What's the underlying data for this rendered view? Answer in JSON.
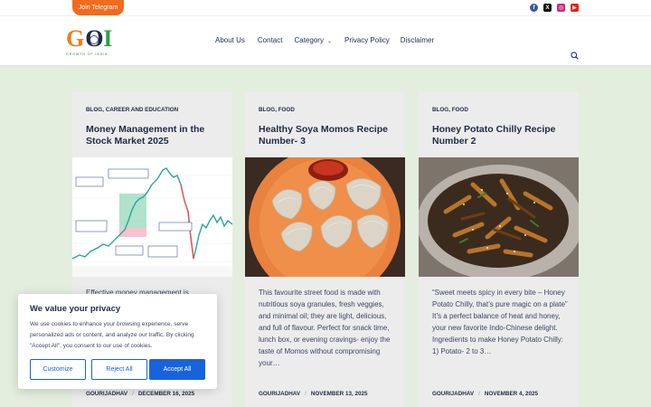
{
  "topbar": {
    "telegram_label": "Join Telegram"
  },
  "socials": [
    "facebook-icon",
    "x-icon",
    "instagram-icon",
    "youtube-icon"
  ],
  "logo": {
    "tagline": "GROWTH OF INDIA"
  },
  "nav": {
    "about": "About Us",
    "contact": "Contact",
    "category": "Category",
    "privacy": "Privacy Policy",
    "disclaimer": "Disclaimer"
  },
  "posts": [
    {
      "categories": "BLOG, CAREER AND EDUCATION",
      "title": "Money Management in the Stock Market 2025",
      "excerpt": "Effective money management is",
      "author": "GOURIJADHAV",
      "date": "DECEMBER 16, 2025"
    },
    {
      "categories": "BLOG, FOOD",
      "title": "Healthy Soya Momos Recipe Number- 3",
      "excerpt": "This favourite street food is made with nutritious soya granules, fresh veggies, and minimal oil; they are light, delicious, and full of flavour. Perfect for snack time, lunch box, or evening cravings- enjoy the taste of Momos without compromising your…",
      "author": "GOURIJADHAV",
      "date": "NOVEMBER 13, 2025"
    },
    {
      "categories": "BLOG, FOOD",
      "title": "Honey Potato Chilly Recipe Number 2",
      "excerpt": "“Sweet meets spicy in every bite – Honey Potato Chilly, that’s pure magic on a plate” It’s a perfect balance of heat and honey, your new favorite Indo-Chinese delight. Ingredients to make Honey Potato Chilly: 1) Potato- 2 to 3…",
      "author": "GOURIJADHAV",
      "date": "NOVEMBER 4, 2025"
    }
  ],
  "cookie": {
    "title": "We value your privacy",
    "text": "We use cookies to enhance your browsing experience, serve personalized ads or content, and analyze our traffic. By clicking \"Accept All\", you consent to our use of cookies.",
    "customize": "Customize",
    "reject": "Reject All",
    "accept": "Accept All"
  },
  "colors": {
    "accent": "#f06b1d",
    "primary_button": "#1863dc",
    "page_bg": "#e3eedf"
  }
}
